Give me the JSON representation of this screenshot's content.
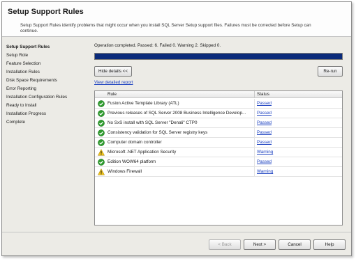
{
  "header": {
    "title": "Setup Support Rules",
    "description": "Setup Support Rules identify problems that might occur when you install SQL Server Setup support files. Failures must be corrected before Setup can continue."
  },
  "sidebar": {
    "items": [
      {
        "label": "Setup Support Rules",
        "active": true
      },
      {
        "label": "Setup Role"
      },
      {
        "label": "Feature Selection"
      },
      {
        "label": "Installation Rules"
      },
      {
        "label": "Disk Space Requirements"
      },
      {
        "label": "Error Reporting"
      },
      {
        "label": "Installation Configuration Rules"
      },
      {
        "label": "Ready to Install"
      },
      {
        "label": "Installation Progress"
      },
      {
        "label": "Complete"
      }
    ]
  },
  "main": {
    "status_text": "Operation completed.  Passed: 6.   Failed 0.   Warning 2.   Skipped 0.",
    "progress": 1.0,
    "hide_details_label": "Hide details <<",
    "rerun_label": "Re-run",
    "view_report_label": "View detailed report",
    "columns": {
      "rule": "Rule",
      "status": "Status"
    },
    "rows": [
      {
        "icon": "passed-check-icon",
        "rule": "Fusion Active Template Library (ATL)",
        "status": "Passed"
      },
      {
        "icon": "passed-check-icon",
        "rule": "Previous releases of SQL Server 2008 Business Intelligence Develop...",
        "status": "Passed"
      },
      {
        "icon": "passed-check-icon",
        "rule": "No SxS install with SQL Server \"Denali\" CTP0",
        "status": "Passed"
      },
      {
        "icon": "passed-check-icon",
        "rule": "Consistency validation for SQL Server registry keys",
        "status": "Passed"
      },
      {
        "icon": "passed-check-icon",
        "rule": "Computer domain controller",
        "status": "Passed"
      },
      {
        "icon": "warning-icon",
        "rule": "Microsoft .NET Application Security",
        "status": "Warning"
      },
      {
        "icon": "passed-check-icon",
        "rule": "Edition WOW64 platform",
        "status": "Passed"
      },
      {
        "icon": "warning-icon",
        "rule": "Windows Firewall",
        "status": "Warning"
      }
    ]
  },
  "footer": {
    "back_label": "< Back",
    "next_label": "Next >",
    "cancel_label": "Cancel",
    "help_label": "Help"
  },
  "colors": {
    "progress_fill": "#0a2a7a",
    "link": "#1a3fc0",
    "passed": "#2e9b2e",
    "warning": "#f0c419"
  }
}
